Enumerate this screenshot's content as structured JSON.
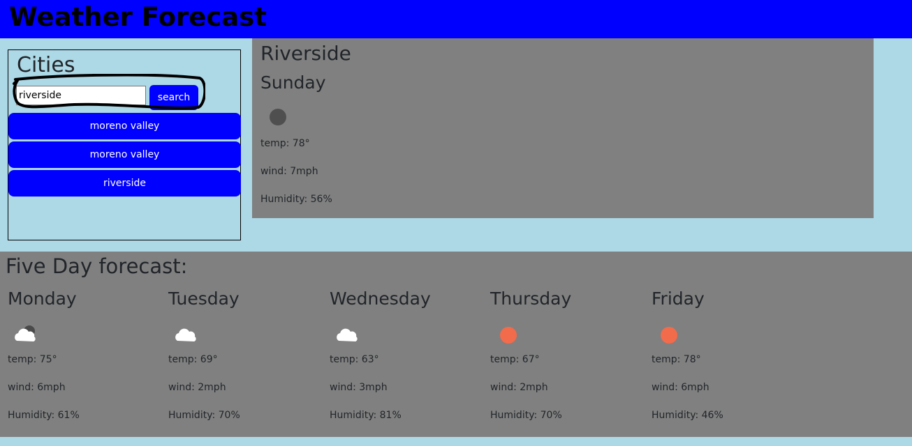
{
  "header": {
    "title": "Weather Forecast"
  },
  "sidebar": {
    "title": "Cities",
    "search": {
      "value": "riverside",
      "button_label": "search"
    },
    "history": [
      {
        "label": "moreno valley"
      },
      {
        "label": "moreno valley"
      },
      {
        "label": "riverside"
      }
    ]
  },
  "current": {
    "city": "Riverside",
    "day": "Sunday",
    "icon": "dark-dot-icon",
    "temp": "temp: 78°",
    "wind": "wind: 7mph",
    "humidity": "Humidity: 56%"
  },
  "forecast": {
    "title": "Five Day forecast:",
    "days": [
      {
        "day": "Monday",
        "icon": "partly-cloudy-icon",
        "temp": "temp: 75°",
        "wind": "wind: 6mph",
        "humidity": "Humidity: 61%"
      },
      {
        "day": "Tuesday",
        "icon": "cloud-icon",
        "temp": "temp: 69°",
        "wind": "wind: 2mph",
        "humidity": "Humidity: 70%"
      },
      {
        "day": "Wednesday",
        "icon": "cloud-icon",
        "temp": "temp: 63°",
        "wind": "wind: 3mph",
        "humidity": "Humidity: 81%"
      },
      {
        "day": "Thursday",
        "icon": "sun-icon",
        "temp": "temp: 67°",
        "wind": "wind: 2mph",
        "humidity": "Humidity: 70%"
      },
      {
        "day": "Friday",
        "icon": "sun-icon",
        "temp": "temp: 78°",
        "wind": "wind: 6mph",
        "humidity": "Humidity: 46%"
      }
    ]
  },
  "colors": {
    "background": "#add8e6",
    "header": "#0000ff",
    "button": "#0000ff",
    "panel": "#808080",
    "sun": "#f26b4b",
    "cloud": "#ffffff"
  }
}
